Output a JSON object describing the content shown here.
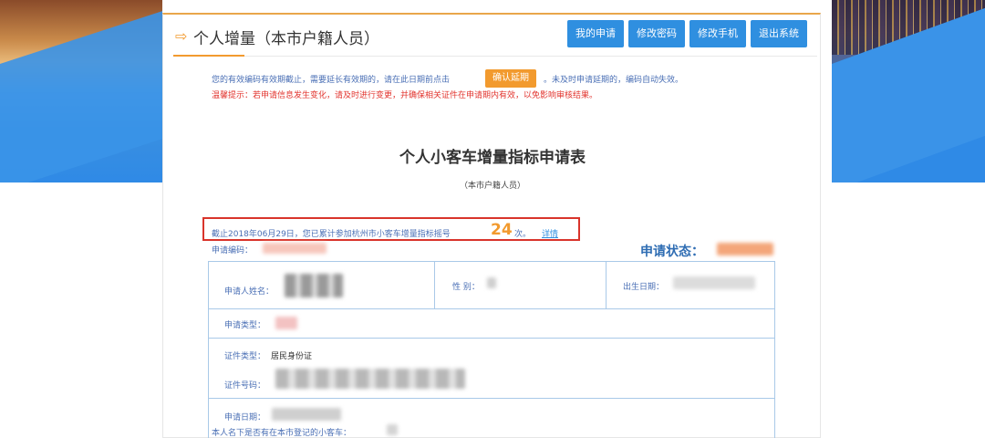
{
  "header": {
    "title": "个人增量（本市户籍人员）",
    "buttons": [
      "我的申请",
      "修改密码",
      "修改手机",
      "退出系统"
    ]
  },
  "notices": {
    "line1_before": "您的有效编码有效期截止，需要延长有效期的，请在此日期前点击",
    "confirm_button": "确认延期",
    "line1_after": "。未及时申请延期的，编码自动失效。",
    "line2": "温馨提示：若申请信息发生变化，请及时进行变更，并确保相关证件在申请期内有效，以免影响审核结果。"
  },
  "form": {
    "title": "个人小客车增量指标申请表",
    "subtitle": "（本市户籍人员）",
    "count_prefix": "截止2018年06月29日，您已累计参加杭州市小客车增量指标摇号",
    "count_value": "24",
    "count_unit": "次。",
    "detail_link": "详情",
    "app_code_label": "申请编码：",
    "status_label": "申请状态："
  },
  "table": {
    "name_label": "申请人姓名：",
    "gender_label": "性 别：",
    "birth_label": "出生日期：",
    "type_label": "申请类型：",
    "id_type_label": "证件类型：",
    "id_type_value": "居民身份证",
    "id_number_label": "证件号码：",
    "apply_date_label": "申请日期：",
    "own_car_label": "本人名下是否有在本市登记的小客车："
  },
  "colors": {
    "accent_orange": "#f29a2e",
    "button_blue": "#2f8fe0",
    "highlight_red": "#d9342b"
  },
  "icons": {
    "title_icon": "arrow-right-icon"
  }
}
